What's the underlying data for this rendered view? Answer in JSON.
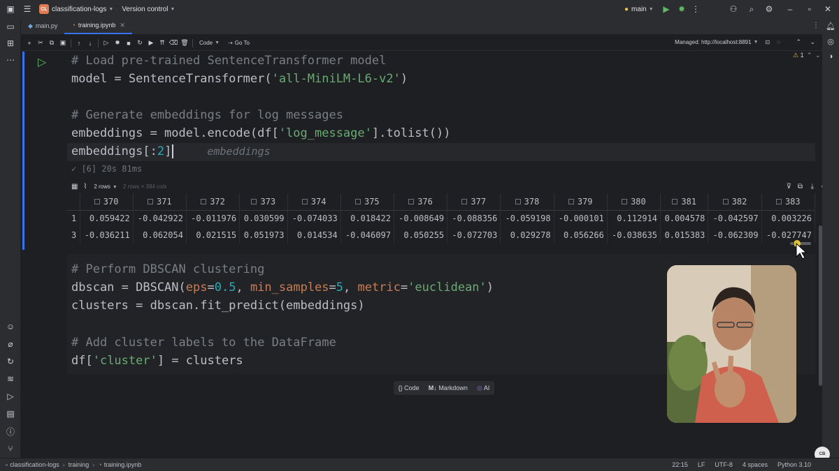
{
  "titlebar": {
    "project_badge": "CL",
    "project_name": "classification-logs",
    "vcs": "Version control",
    "branch": "main"
  },
  "tabs": [
    {
      "label": "main.py",
      "active": false
    },
    {
      "label": "training.ipynb",
      "active": true
    }
  ],
  "nbtoolbar": {
    "cell_type": "Code",
    "goto": "Go To",
    "managed": "Managed: http://localhost:8891",
    "warning_count": "1"
  },
  "cell1": {
    "line1": "# Load pre-trained SentenceTransformer model",
    "line2_pre": "model = SentenceTransformer(",
    "line2_str": "'all-MiniLM-L6-v2'",
    "line2_post": ")",
    "line4": "# Generate embeddings for log messages",
    "line5_pre": "embeddings = model.encode(df[",
    "line5_str": "'log_message'",
    "line5_post": "].tolist())",
    "line6_pre": "embeddings[:",
    "line6_num": "2",
    "line6_post": "]",
    "line6_hint": "embeddings",
    "exec_info": "✓ [6] 20s 81ms"
  },
  "output": {
    "rows_select": "2 rows",
    "shape": "2 rows × 384 cols",
    "columns": [
      "370",
      "371",
      "372",
      "373",
      "374",
      "375",
      "376",
      "377",
      "378",
      "379",
      "380",
      "381",
      "382",
      "383"
    ],
    "rows": [
      {
        "index": "1",
        "values": [
          "0.059422",
          "-0.042922",
          "-0.011976",
          "0.030599",
          "-0.074033",
          "0.018422",
          "-0.008649",
          "-0.088356",
          "-0.059198",
          "-0.000101",
          "0.112914",
          "0.004578",
          "-0.042597",
          "0.003226"
        ]
      },
      {
        "index": "3",
        "values": [
          "-0.036211",
          "0.062054",
          "0.021515",
          "0.051973",
          "0.014534",
          "-0.046097",
          "0.050255",
          "-0.072703",
          "0.029278",
          "0.056266",
          "-0.038635",
          "0.015383",
          "-0.062309",
          "-0.027747"
        ]
      }
    ]
  },
  "cell2": {
    "line1": "# Perform DBSCAN clustering",
    "line2_pre": "dbscan = DBSCAN(",
    "kw_eps": "eps",
    "eq1": "=",
    "num_eps": "0.5",
    "comma1": ", ",
    "kw_min": "min_samples",
    "eq2": "=",
    "num_min": "5",
    "comma2": ", ",
    "kw_metric": "metric",
    "eq3": "=",
    "str_metric": "'euclidean'",
    "line2_post": ")",
    "line3": "clusters = dbscan.fit_predict(embeddings)",
    "line5": "# Add cluster labels to the DataFrame",
    "line6_pre": "df[",
    "line6_str": "'cluster'",
    "line6_post": "] = clusters"
  },
  "addbar": {
    "code": "Code",
    "markdown": "Markdown",
    "ai": "AI"
  },
  "statusbar": {
    "crumbs": [
      "classification-logs",
      "training",
      "training.ipynb"
    ],
    "position": "22:15",
    "line_sep": "LF",
    "encoding": "UTF-8",
    "indent": "4 spaces",
    "interpreter": "Python 3.10"
  },
  "colors": {
    "accent": "#3574f0",
    "run_green": "#5fb865",
    "string": "#6aab73",
    "number": "#2aacb8",
    "keyword_arg": "#c77d55",
    "comment": "#7a7e85"
  }
}
